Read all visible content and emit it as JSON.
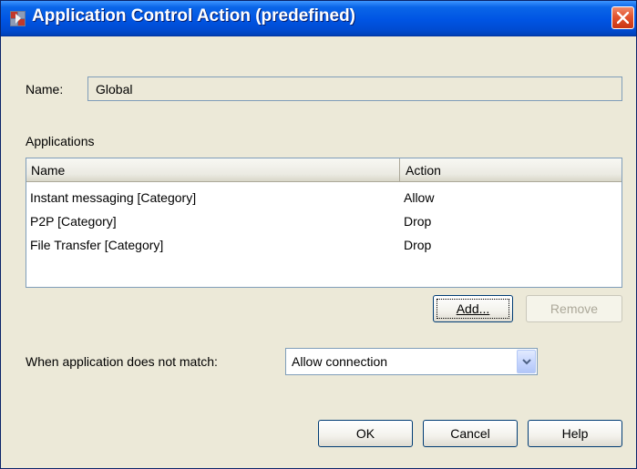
{
  "window": {
    "title": "Application Control Action (predefined)",
    "icon": "firewall-icon",
    "close_icon": "close-icon"
  },
  "name_field": {
    "label": "Name:",
    "value": "Global"
  },
  "applications": {
    "section_label": "Applications",
    "columns": [
      "Name",
      "Action"
    ],
    "rows": [
      {
        "name": "Instant messaging [Category]",
        "action": "Allow"
      },
      {
        "name": "P2P [Category]",
        "action": "Drop"
      },
      {
        "name": "File Transfer [Category]",
        "action": "Drop"
      }
    ],
    "add_label": "Add...",
    "remove_label": "Remove"
  },
  "no_match": {
    "label": "When application does not match:",
    "selected": "Allow connection"
  },
  "footer": {
    "ok_label": "OK",
    "cancel_label": "Cancel",
    "help_label": "Help"
  },
  "colors": {
    "titlebar": "#0054e3",
    "dialog_bg": "#ece9d8",
    "close_button": "#e2532e"
  }
}
